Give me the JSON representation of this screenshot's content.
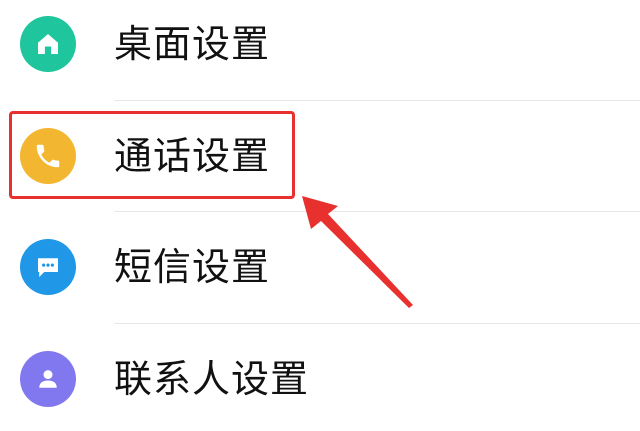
{
  "settings": {
    "items": [
      {
        "label": "桌面设置",
        "icon": "home-icon",
        "color": "#1fc59c"
      },
      {
        "label": "通话设置",
        "icon": "phone-icon",
        "color": "#f3b630"
      },
      {
        "label": "短信设置",
        "icon": "message-icon",
        "color": "#2197e8"
      },
      {
        "label": "联系人设置",
        "icon": "contact-icon",
        "color": "#8178f0"
      }
    ]
  },
  "annotation": {
    "highlighted_item": "通话设置",
    "color": "#e8312f"
  }
}
